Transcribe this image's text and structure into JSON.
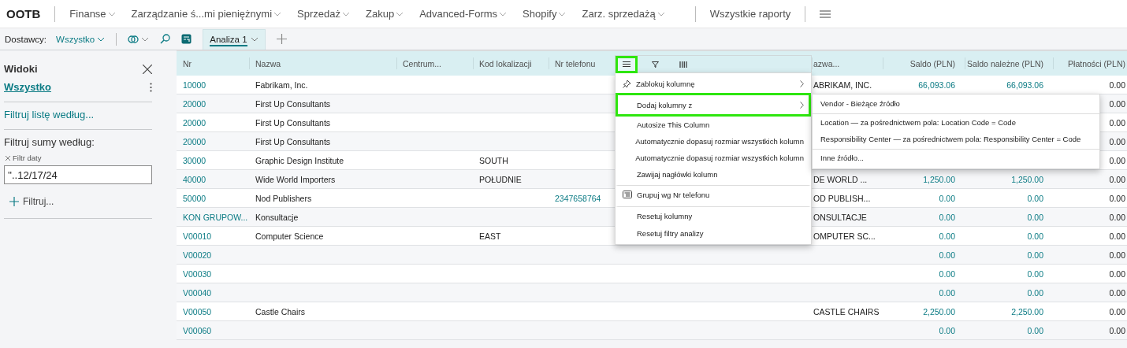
{
  "nav": {
    "brand": "OOTB",
    "menus": [
      {
        "label": "Finanse"
      },
      {
        "label": "Zarządzanie ś...mi pieniężnymi"
      },
      {
        "label": "Sprzedaż"
      },
      {
        "label": "Zakup"
      },
      {
        "label": "Advanced-Forms"
      },
      {
        "label": "Shopify"
      },
      {
        "label": "Zarz. sprzedażą"
      }
    ],
    "reports": "Wszystkie raporty"
  },
  "toolbar": {
    "filter_label": "Dostawcy:",
    "filter_value": "Wszystko",
    "tabs": [
      {
        "label": "Analiza 1",
        "selected": true
      }
    ]
  },
  "views_panel": {
    "title": "Widoki",
    "views": [
      {
        "label": "Wszystko",
        "selected": true
      }
    ],
    "filter_list_link": "Filtruj listę według...",
    "totals_title": "Filtruj sumy według:",
    "date_filter": {
      "label": "Filtr daty",
      "value": "''..12/17/24"
    },
    "add_filter": "Filtruj..."
  },
  "table": {
    "columns": [
      {
        "label": "Nr",
        "kind": "link"
      },
      {
        "label": "Nazwa",
        "kind": "text"
      },
      {
        "label": "Centrum...",
        "kind": "text"
      },
      {
        "label": "Kod lokalizacji",
        "kind": "text"
      },
      {
        "label": "Nr telefonu",
        "kind": "link"
      },
      {
        "label": "azwa...",
        "kind": "text"
      },
      {
        "label": "Saldo (PLN)",
        "kind": "amount_link"
      },
      {
        "label": "Saldo należne (PLN)",
        "kind": "amount_link"
      },
      {
        "label": "Płatności (PLN)",
        "kind": "amount"
      }
    ],
    "rows": [
      {
        "cells": [
          "10000",
          "Fabrikam, Inc.",
          null,
          null,
          null,
          "ABRIKAM, INC.",
          "66,093.06",
          "66,093.06",
          "0.00"
        ]
      },
      {
        "cells": [
          "20000",
          "First Up Consultants",
          null,
          null,
          null,
          null,
          null,
          null,
          "0.00"
        ]
      },
      {
        "cells": [
          "20000",
          "First Up Consultants",
          null,
          null,
          null,
          null,
          null,
          null,
          "0.00"
        ]
      },
      {
        "cells": [
          "20000",
          "First Up Consultants",
          null,
          null,
          null,
          null,
          null,
          null,
          "0.00"
        ]
      },
      {
        "cells": [
          "30000",
          "Graphic Design Institute",
          null,
          "SOUTH",
          null,
          null,
          null,
          null,
          "0.00"
        ]
      },
      {
        "cells": [
          "40000",
          "Wide World Importers",
          null,
          "POŁUDNIE",
          null,
          "DE WORLD ...",
          "1,250.00",
          "1,250.00",
          "0.00"
        ]
      },
      {
        "cells": [
          "50000",
          "Nod Publishers",
          null,
          null,
          "2347658764",
          "OD PUBLISH...",
          "0.00",
          "0.00",
          "0.00"
        ]
      },
      {
        "cells": [
          "KON GRUPOW...",
          "Konsultacje",
          null,
          null,
          null,
          "ONSULTACJE",
          "0.00",
          "0.00",
          "0.00"
        ]
      },
      {
        "cells": [
          "V00010",
          "Computer Science",
          null,
          "EAST",
          null,
          "OMPUTER SC...",
          "0.00",
          "0.00",
          "0.00"
        ]
      },
      {
        "cells": [
          "V00020",
          null,
          null,
          null,
          null,
          null,
          "0.00",
          "0.00",
          "0.00"
        ]
      },
      {
        "cells": [
          "V00030",
          null,
          null,
          null,
          null,
          null,
          "0.00",
          "0.00",
          "0.00"
        ]
      },
      {
        "cells": [
          "V00040",
          null,
          null,
          null,
          null,
          null,
          "0.00",
          "0.00",
          "0.00"
        ]
      },
      {
        "cells": [
          "V00050",
          "Castle Chairs",
          null,
          null,
          null,
          "CASTLE CHAIRS",
          "2,250.00",
          "2,250.00",
          "0.00"
        ]
      },
      {
        "cells": [
          "V00060",
          null,
          null,
          null,
          null,
          null,
          "0.00",
          "0.00",
          "0.00"
        ]
      }
    ]
  },
  "column_menu": {
    "header_tabs": [
      {
        "kind": "menu",
        "selected": true
      },
      {
        "kind": "filter",
        "selected": false
      },
      {
        "kind": "columns",
        "selected": false
      }
    ],
    "items": [
      {
        "label": "Zablokuj kolumnę",
        "kind": "pin",
        "submenu": true,
        "highlighted": false,
        "divider_before": false
      },
      {
        "label": "Dodaj kolumny z",
        "kind": "plain",
        "submenu": true,
        "highlighted": true,
        "divider_before": false
      },
      {
        "label": "Autosize This Column",
        "kind": "plain",
        "submenu": false,
        "highlighted": false,
        "divider_before": false
      },
      {
        "label": "Automatycznie dopasuj rozmiar wszystkich kolumn",
        "kind": "plain",
        "submenu": false,
        "highlighted": false,
        "divider_before": false
      },
      {
        "label": "Automatycznie dopasuj rozmiar wszystkich kolumn",
        "kind": "plain",
        "submenu": false,
        "highlighted": false,
        "divider_before": false
      },
      {
        "label": "Zawijaj nagłówki kolumn",
        "kind": "plain",
        "submenu": false,
        "highlighted": false,
        "divider_before": false
      },
      {
        "label": "Grupuj wg Nr telefonu",
        "kind": "group",
        "submenu": false,
        "highlighted": false,
        "divider_before": true
      },
      {
        "label": "Resetuj kolumny",
        "kind": "plain",
        "submenu": false,
        "highlighted": false,
        "divider_before": true
      },
      {
        "label": "Resetuj filtry analizy",
        "kind": "plain",
        "submenu": false,
        "highlighted": false,
        "divider_before": false
      }
    ]
  },
  "sub_menu": {
    "items": [
      {
        "label": "Vendor - Bieżące źródło",
        "divider_before": false
      },
      {
        "label": "Location — za pośrednictwem pola: Location Code = Code",
        "divider_before": true
      },
      {
        "label": "Responsibility Center — za pośrednictwem pola: Responsibility Center = Code",
        "divider_before": false
      },
      {
        "label": "Inne źródło...",
        "divider_before": true
      }
    ]
  }
}
